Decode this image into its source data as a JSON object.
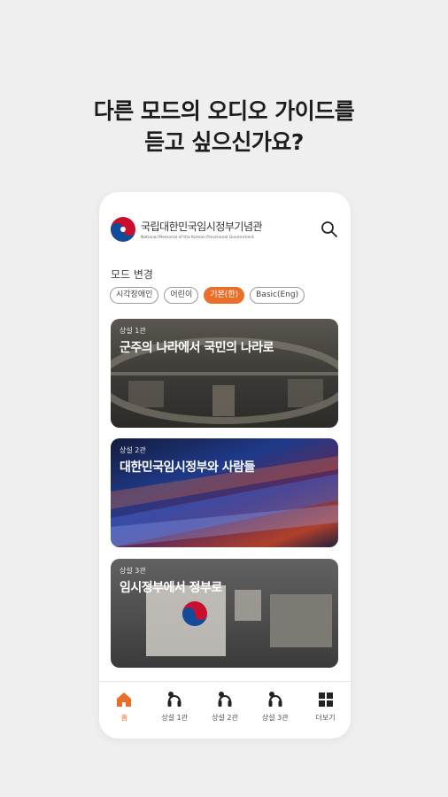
{
  "headline": {
    "line1": "다른 모드의 오디오 가이드를",
    "line2": "듣고 싶으신가요?"
  },
  "header": {
    "logo_ko": "국립대한민국임시정부기념관",
    "logo_en": "National Memorial of the Korean Provisional Government",
    "search_icon": "search-icon"
  },
  "mode": {
    "label": "모드 변경",
    "chips": [
      "시각장애인",
      "어린이",
      "기본(한)",
      "Basic(Eng)"
    ],
    "active": "기본(한)"
  },
  "cards": [
    {
      "tag": "상설 1관",
      "title": "군주의 나라에서 국민의 나라로"
    },
    {
      "tag": "상설 2관",
      "title": "대한민국임시정부와 사람들"
    },
    {
      "tag": "상설 3관",
      "title": "임시정부에서 정부로"
    }
  ],
  "nav": {
    "items": [
      {
        "label": "홈",
        "icon": "home-icon"
      },
      {
        "label": "상설 1관",
        "icon": "audio-guide-icon"
      },
      {
        "label": "상설 2관",
        "icon": "audio-guide-icon"
      },
      {
        "label": "상설 3관",
        "icon": "audio-guide-icon"
      },
      {
        "label": "더보기",
        "icon": "grid-icon"
      }
    ]
  },
  "colors": {
    "accent": "#e8702a",
    "background": "#efefef"
  }
}
